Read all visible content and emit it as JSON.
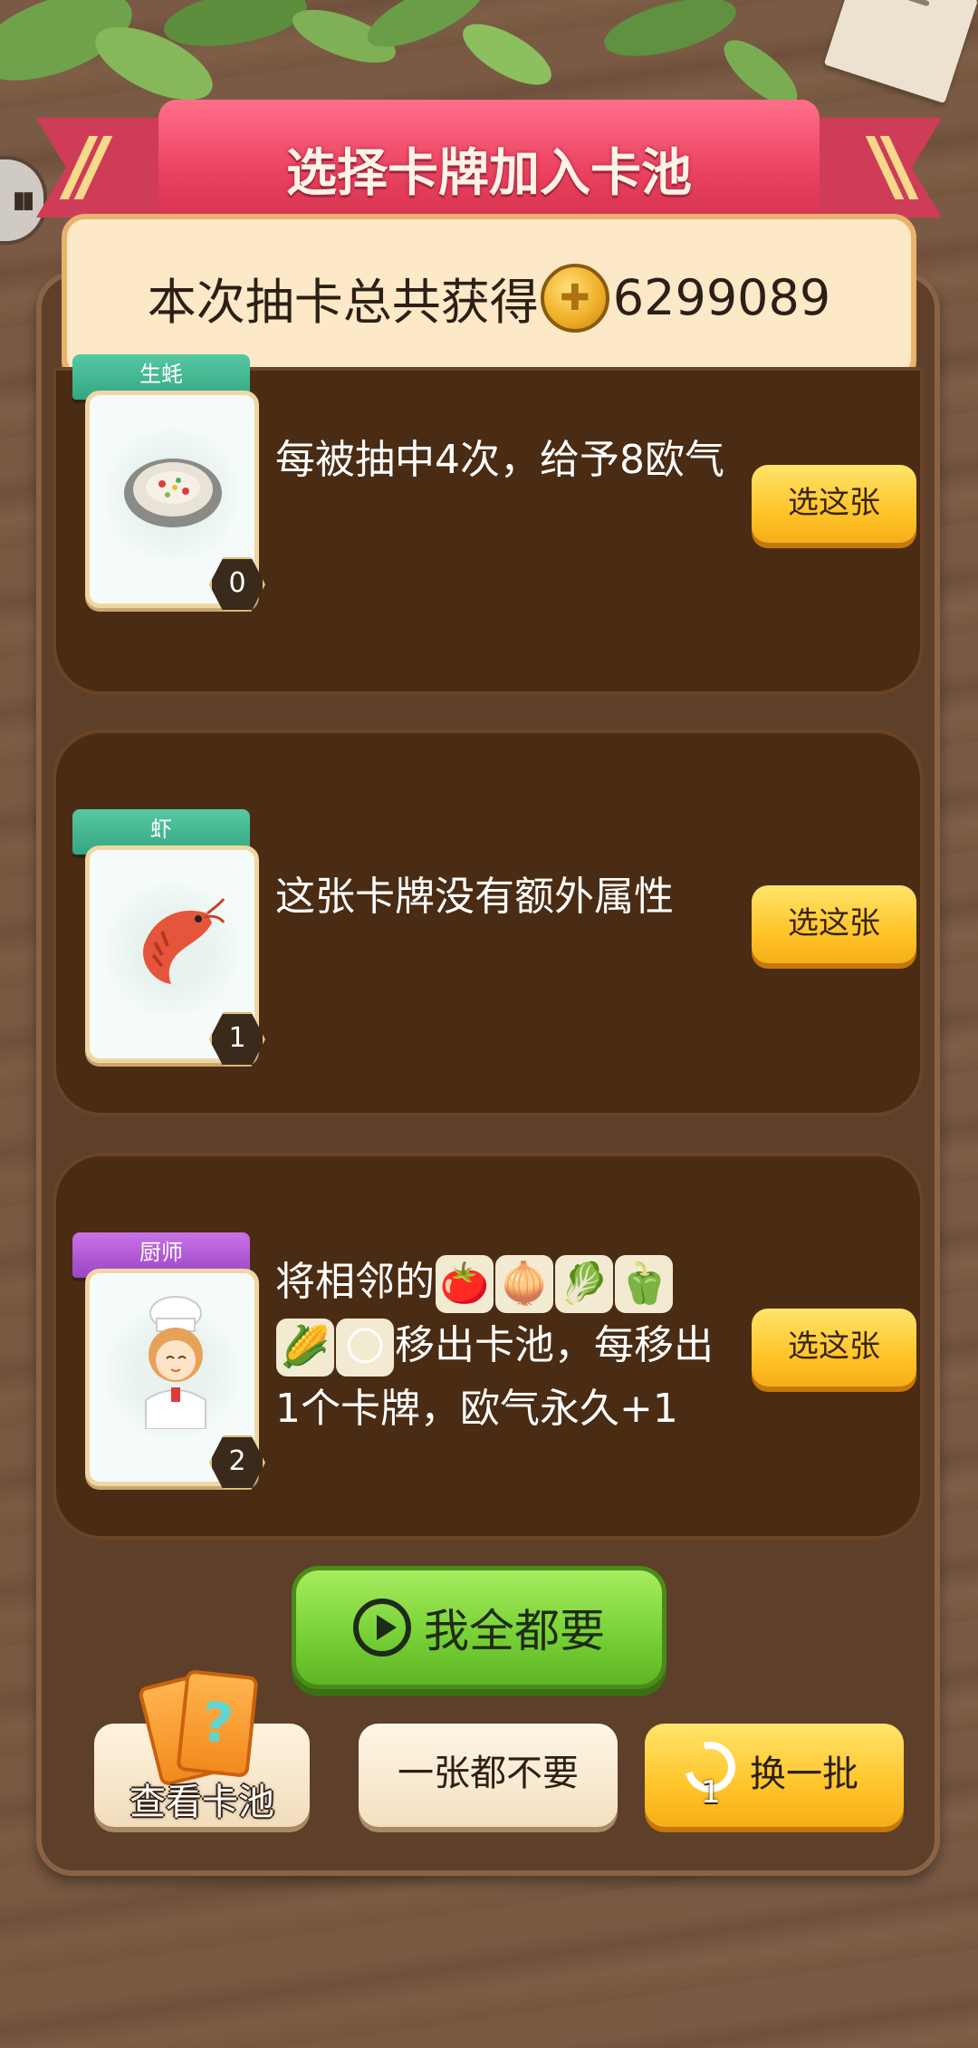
{
  "title": "选择卡牌加入卡池",
  "total": {
    "label": "本次抽卡总共获得",
    "amount": "6299089",
    "icon": "coin-icon"
  },
  "cards": [
    {
      "name": "生蚝",
      "level": "0",
      "banner_color": "green",
      "description": "每被抽中4次，给予8欧气",
      "button": "选这张"
    },
    {
      "name": "虾",
      "level": "1",
      "banner_color": "green",
      "description": "这张卡牌没有额外属性",
      "button": "选这张"
    },
    {
      "name": "厨师",
      "level": "2",
      "banner_color": "purple",
      "description_prefix": "将相邻的",
      "description_icons": [
        "tomato",
        "onion",
        "lettuce",
        "green-pepper",
        "corn",
        "corn-kernels"
      ],
      "description_mid": "移出卡池，每移出",
      "description_suffix": "1个卡牌，欧气永久+1",
      "button": "选这张"
    }
  ],
  "buttons": {
    "take_all": "我全都要",
    "view_pool": "查看卡池",
    "take_none": "一张都不要",
    "reroll": "换一批",
    "reroll_count": "1"
  }
}
